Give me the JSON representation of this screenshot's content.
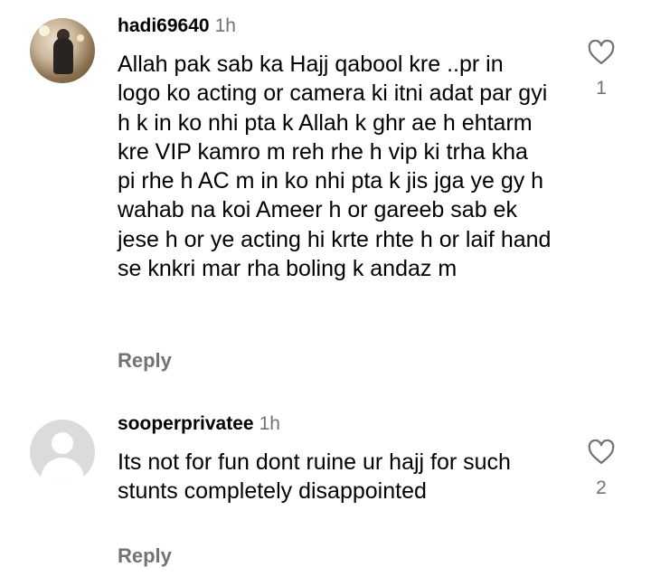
{
  "comments": [
    {
      "username": "hadi69640",
      "time": "1h",
      "text": "Allah pak sab ka Hajj qabool kre ..pr in logo ko acting or camera ki itni adat par gyi h k in ko nhi pta k Allah k ghr ae h ehtarm kre VIP kamro m reh rhe h vip ki trha kha pi rhe h AC m in ko nhi pta k jis jga ye gy h wahab na koi Ameer h or gareeb sab ek jese h or ye acting hi krte rhte h or laif hand se knkri mar rha boling k andaz m",
      "reply_label": "Reply",
      "like_icon": "heart-outline-icon",
      "like_count": "1",
      "avatar": "profile-photo"
    },
    {
      "username": "sooperprivatee",
      "time": "1h",
      "text": "Its not for fun dont ruine ur hajj for such stunts completely disappointed",
      "reply_label": "Reply",
      "like_icon": "heart-outline-icon",
      "like_count": "2",
      "avatar": "default-avatar"
    }
  ],
  "colors": {
    "text": "#000000",
    "secondary": "#737373",
    "avatar_default_bg": "#dbdbdb"
  }
}
